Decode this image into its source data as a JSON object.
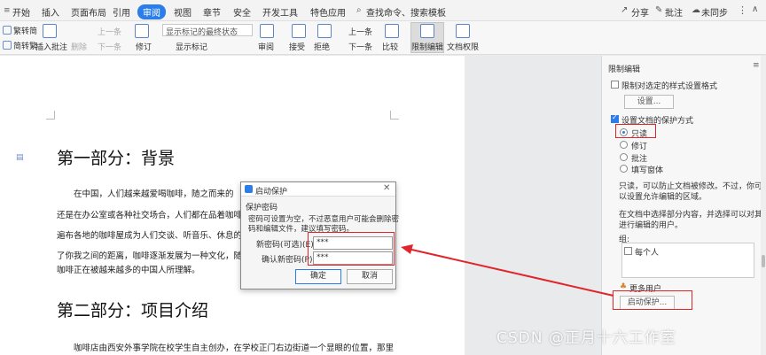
{
  "menu": {
    "tabs": [
      "开始",
      "插入",
      "页面布局",
      "引用",
      "审阅",
      "视图",
      "章节",
      "安全",
      "开发工具",
      "特色应用"
    ],
    "active_tab": "审阅",
    "search_placeholder": "查找命令、搜索模板",
    "share": "分享",
    "comment": "批注",
    "sync": "未同步"
  },
  "ribbon": {
    "trad": "繁转简",
    "simp": "简转繁",
    "insert_comment": "插入批注",
    "delete": "删除",
    "prev1": "上一条",
    "next1": "下一条",
    "show_final": "显示标记的最终状态",
    "show_marks": "显示标记",
    "revise": "修订",
    "review": "审阅",
    "accept": "接受",
    "reject": "拒绝",
    "prev2": "上一条",
    "next2": "下一条",
    "compare": "比较",
    "restrict": "限制编辑",
    "doc_perm": "文档权限"
  },
  "document": {
    "heading1": "第一部分：背景",
    "p1": [
      "在中国，人们越来越爱喝咖啡，随之而来的",
      "还是在办公室或各种社交场合，人们都在品着咖啡",
      "遍布各地的咖啡屋成为人们交谈、听音乐、休息的",
      "了你我之间的距离，咖啡逐渐发展为一种文化，随着",
      "咖啡正在被越来越多的中国人所理解。"
    ],
    "heading2": "第二部分：项目介绍",
    "p2": "咖啡店由西安外事学院在校学生自主创办，在学校正门右边街道一个显眼的位置，那里"
  },
  "panel": {
    "title": "限制编辑",
    "opt1": "限制对选定的样式设置格式",
    "settings": "设置...",
    "opt2": "设置文档的保护方式",
    "radios": [
      "只读",
      "修订",
      "批注",
      "填写窗体"
    ],
    "desc1": "只读，可以防止文档被修改。不过，你可",
    "desc2": "以设置允许编辑的区域。",
    "desc3": "在文档中选择部分内容，并选择可以对其",
    "desc4": "进行编辑的用户。",
    "group_label": "组:",
    "everyone": "每个人",
    "more_users": "更多用户...",
    "start_protect": "启动保护..."
  },
  "dialog": {
    "title": "启动保护",
    "section": "保护密码",
    "note1": "密码可设置为空，不过恶意用户可能会删除密",
    "note2": "码和编辑文件，建议填写密码。",
    "pw_label": "新密码(可选)(E):",
    "pw_value": "***",
    "confirm_label": "确认新密码(P):",
    "confirm_value": "***",
    "ok": "确定",
    "cancel": "取消"
  },
  "watermark": "CSDN @正月十六工作室",
  "colors": {
    "accent": "#2b7de9",
    "highlight": "#e0262b"
  }
}
